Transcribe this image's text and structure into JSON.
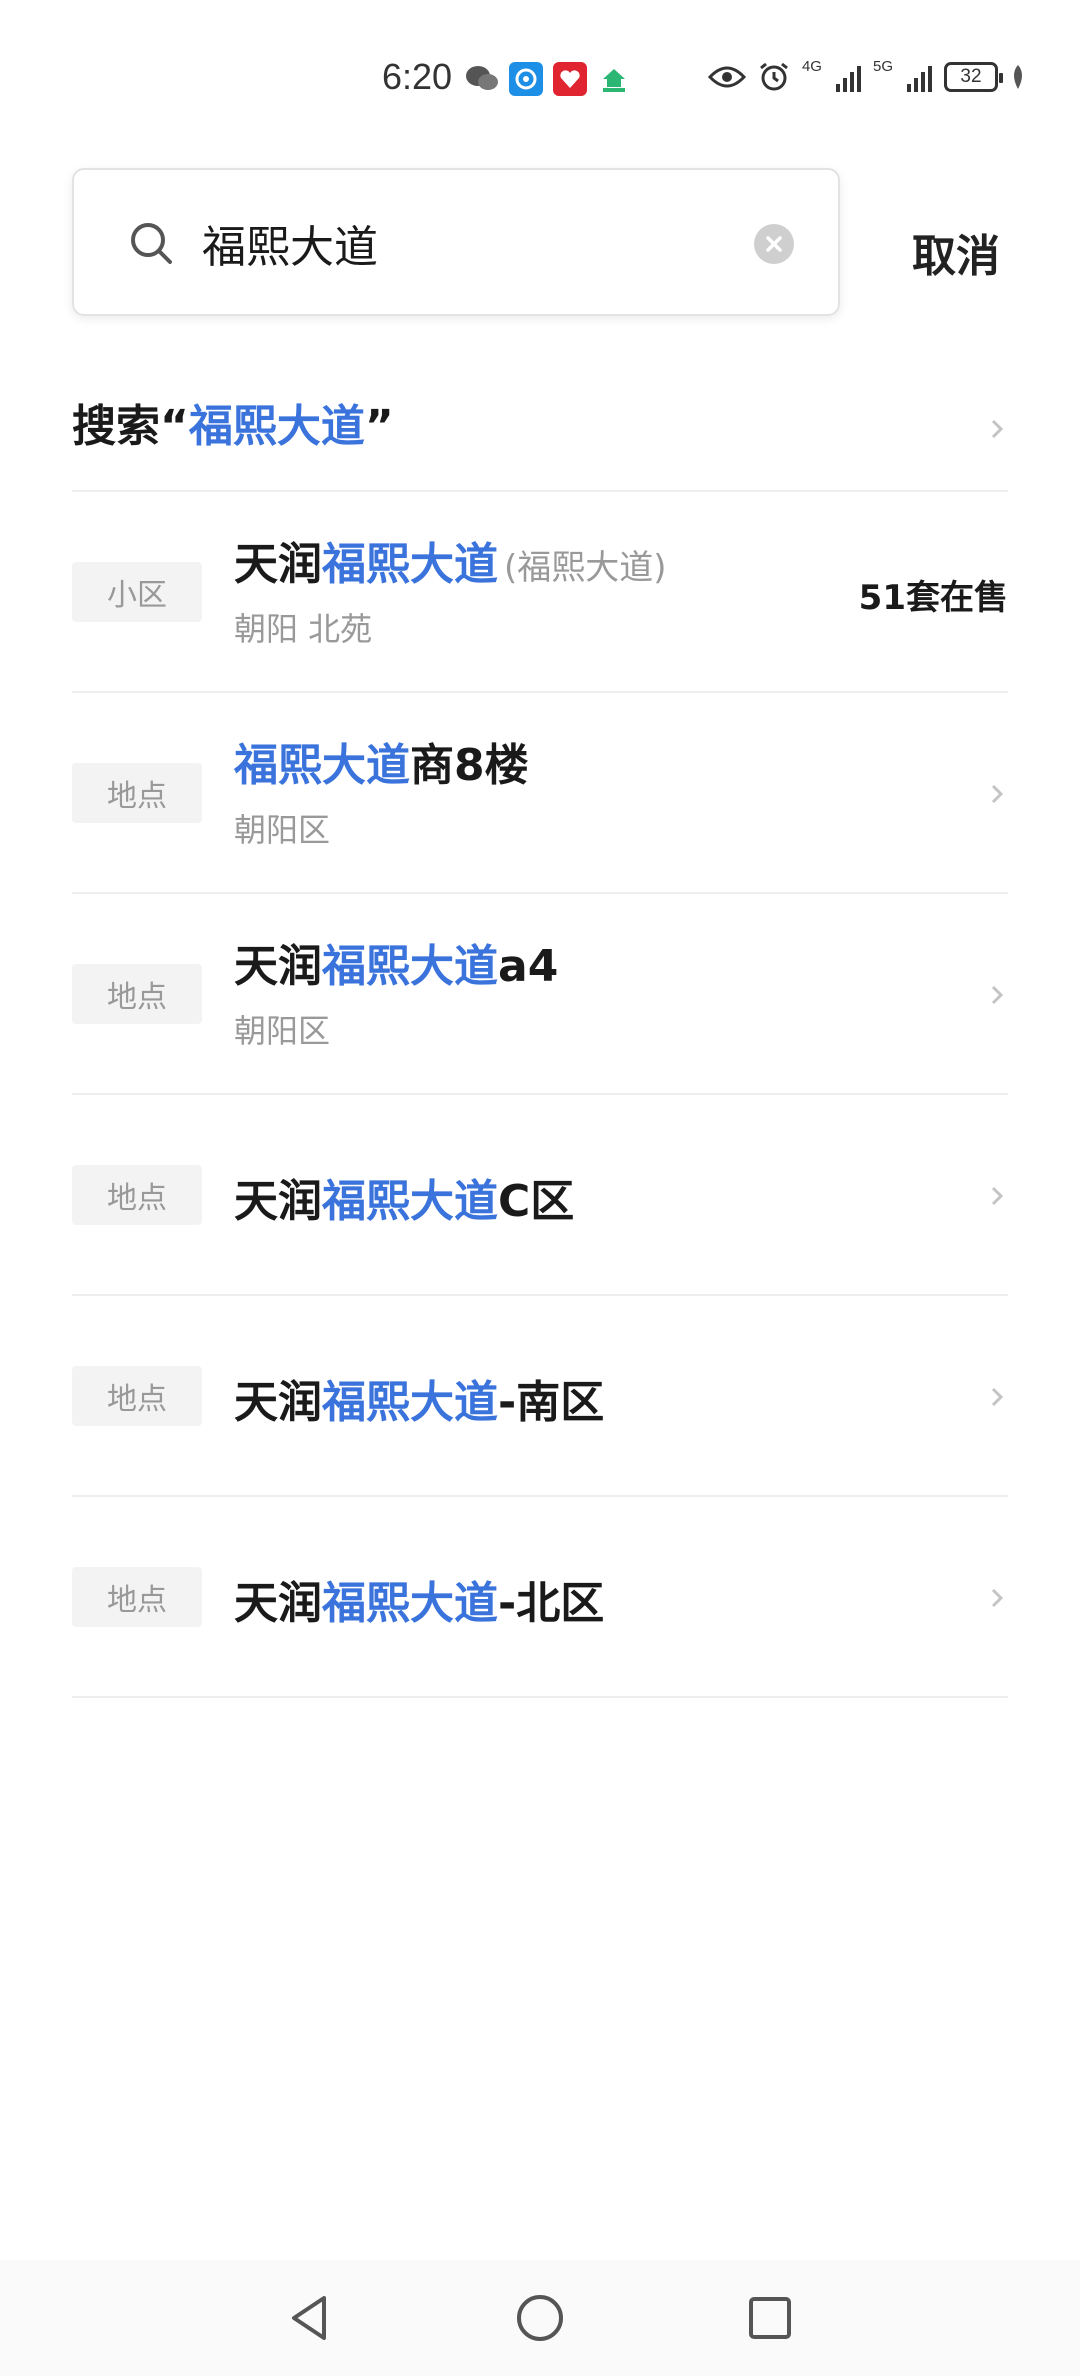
{
  "status_bar": {
    "time": "6:20",
    "apps": [
      {
        "icon": "wechat-icon",
        "color": "#555555"
      },
      {
        "icon": "app-c-icon",
        "color": "#1e8fe6"
      },
      {
        "icon": "heart-app-icon",
        "color": "#e02430"
      },
      {
        "icon": "home-app-icon",
        "color": "#2bb673"
      }
    ],
    "signal_1_label": "4G",
    "signal_2_label": "5G",
    "battery": "32"
  },
  "search": {
    "query": "福熙大道",
    "cancel_label": "取消"
  },
  "search_for": {
    "prefix": "搜索“",
    "keyword": "福熙大道",
    "suffix": "”"
  },
  "colors": {
    "highlight": "#3a73db",
    "text": "#1a1a1a",
    "muted": "#999999"
  },
  "results": [
    {
      "tag": "小区",
      "title_pre": "天润",
      "title_hl": "福熙大道",
      "title_post": "",
      "alias": "(福熙大道)",
      "sub": "朝阳 北苑",
      "count": "51套在售"
    },
    {
      "tag": "地点",
      "title_pre": "",
      "title_hl": "福熙大道",
      "title_post": "商8楼",
      "sub": "朝阳区"
    },
    {
      "tag": "地点",
      "title_pre": "天润",
      "title_hl": "福熙大道",
      "title_post": "a4",
      "sub": "朝阳区"
    },
    {
      "tag": "地点",
      "title_pre": "天润",
      "title_hl": "福熙大道",
      "title_post": "C区"
    },
    {
      "tag": "地点",
      "title_pre": "天润",
      "title_hl": "福熙大道",
      "title_post": "-南区"
    },
    {
      "tag": "地点",
      "title_pre": "天润",
      "title_hl": "福熙大道",
      "title_post": "-北区"
    }
  ]
}
